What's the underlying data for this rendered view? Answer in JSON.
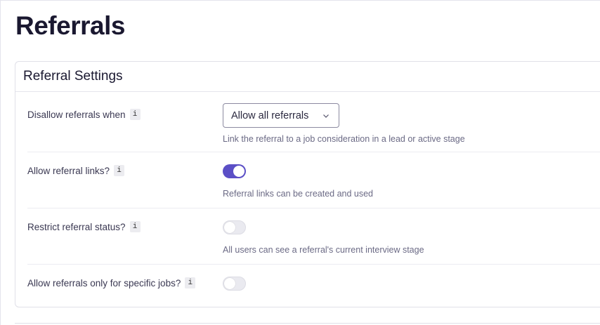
{
  "page": {
    "title": "Referrals"
  },
  "card": {
    "title": "Referral Settings",
    "rows": [
      {
        "label": "Disallow referrals when",
        "info": "i",
        "control": "select",
        "select_value": "Allow all referrals",
        "help": "Link the referral to a job consideration in a lead or active stage"
      },
      {
        "label": "Allow referral links?",
        "info": "i",
        "control": "toggle",
        "toggle_on": true,
        "help": "Referral links can be created and used"
      },
      {
        "label": "Restrict referral status?",
        "info": "i",
        "control": "toggle",
        "toggle_on": false,
        "help": "All users can see a referral's current interview stage"
      },
      {
        "label": "Allow referrals only for specific jobs?",
        "info": "i",
        "control": "toggle",
        "toggle_on": false,
        "help": ""
      }
    ]
  },
  "colors": {
    "accent": "#5b4fc6",
    "help_text": "#6b6a85",
    "title_text": "#1a1830"
  },
  "icons": {
    "info": "info-icon",
    "chevron": "chevron-down-icon"
  }
}
